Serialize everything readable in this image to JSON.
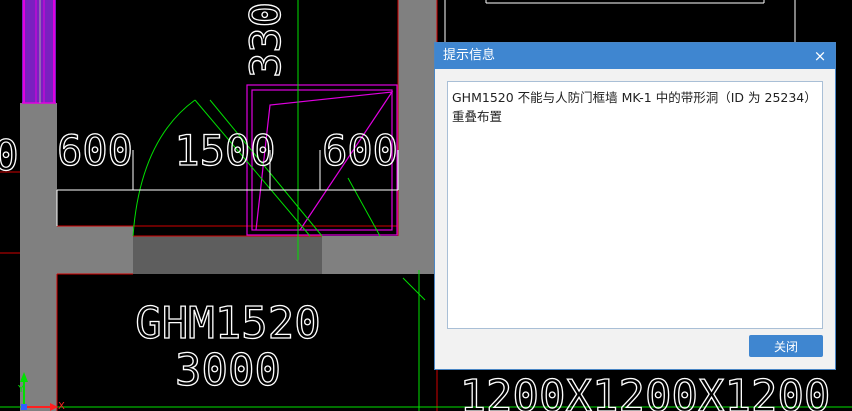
{
  "cad": {
    "dims": [
      "600",
      "1500",
      "600"
    ],
    "vertical_dim": "330",
    "left_edge_text": "0",
    "door_label": "GHM1520",
    "door_sub": "3000",
    "bottom_text": "1200X1200X1200",
    "axis_x": "X",
    "axis_y": "Y",
    "colors": {
      "wall": "#808080",
      "pink": "#e000e0",
      "green": "#00e000",
      "red": "#d00000"
    }
  },
  "dialog": {
    "title": "提示信息",
    "close_glyph": "×",
    "message": "GHM1520 不能与人防门框墙 MK-1 中的带形洞（ID 为 25234）重叠布置",
    "button": "关闭"
  }
}
